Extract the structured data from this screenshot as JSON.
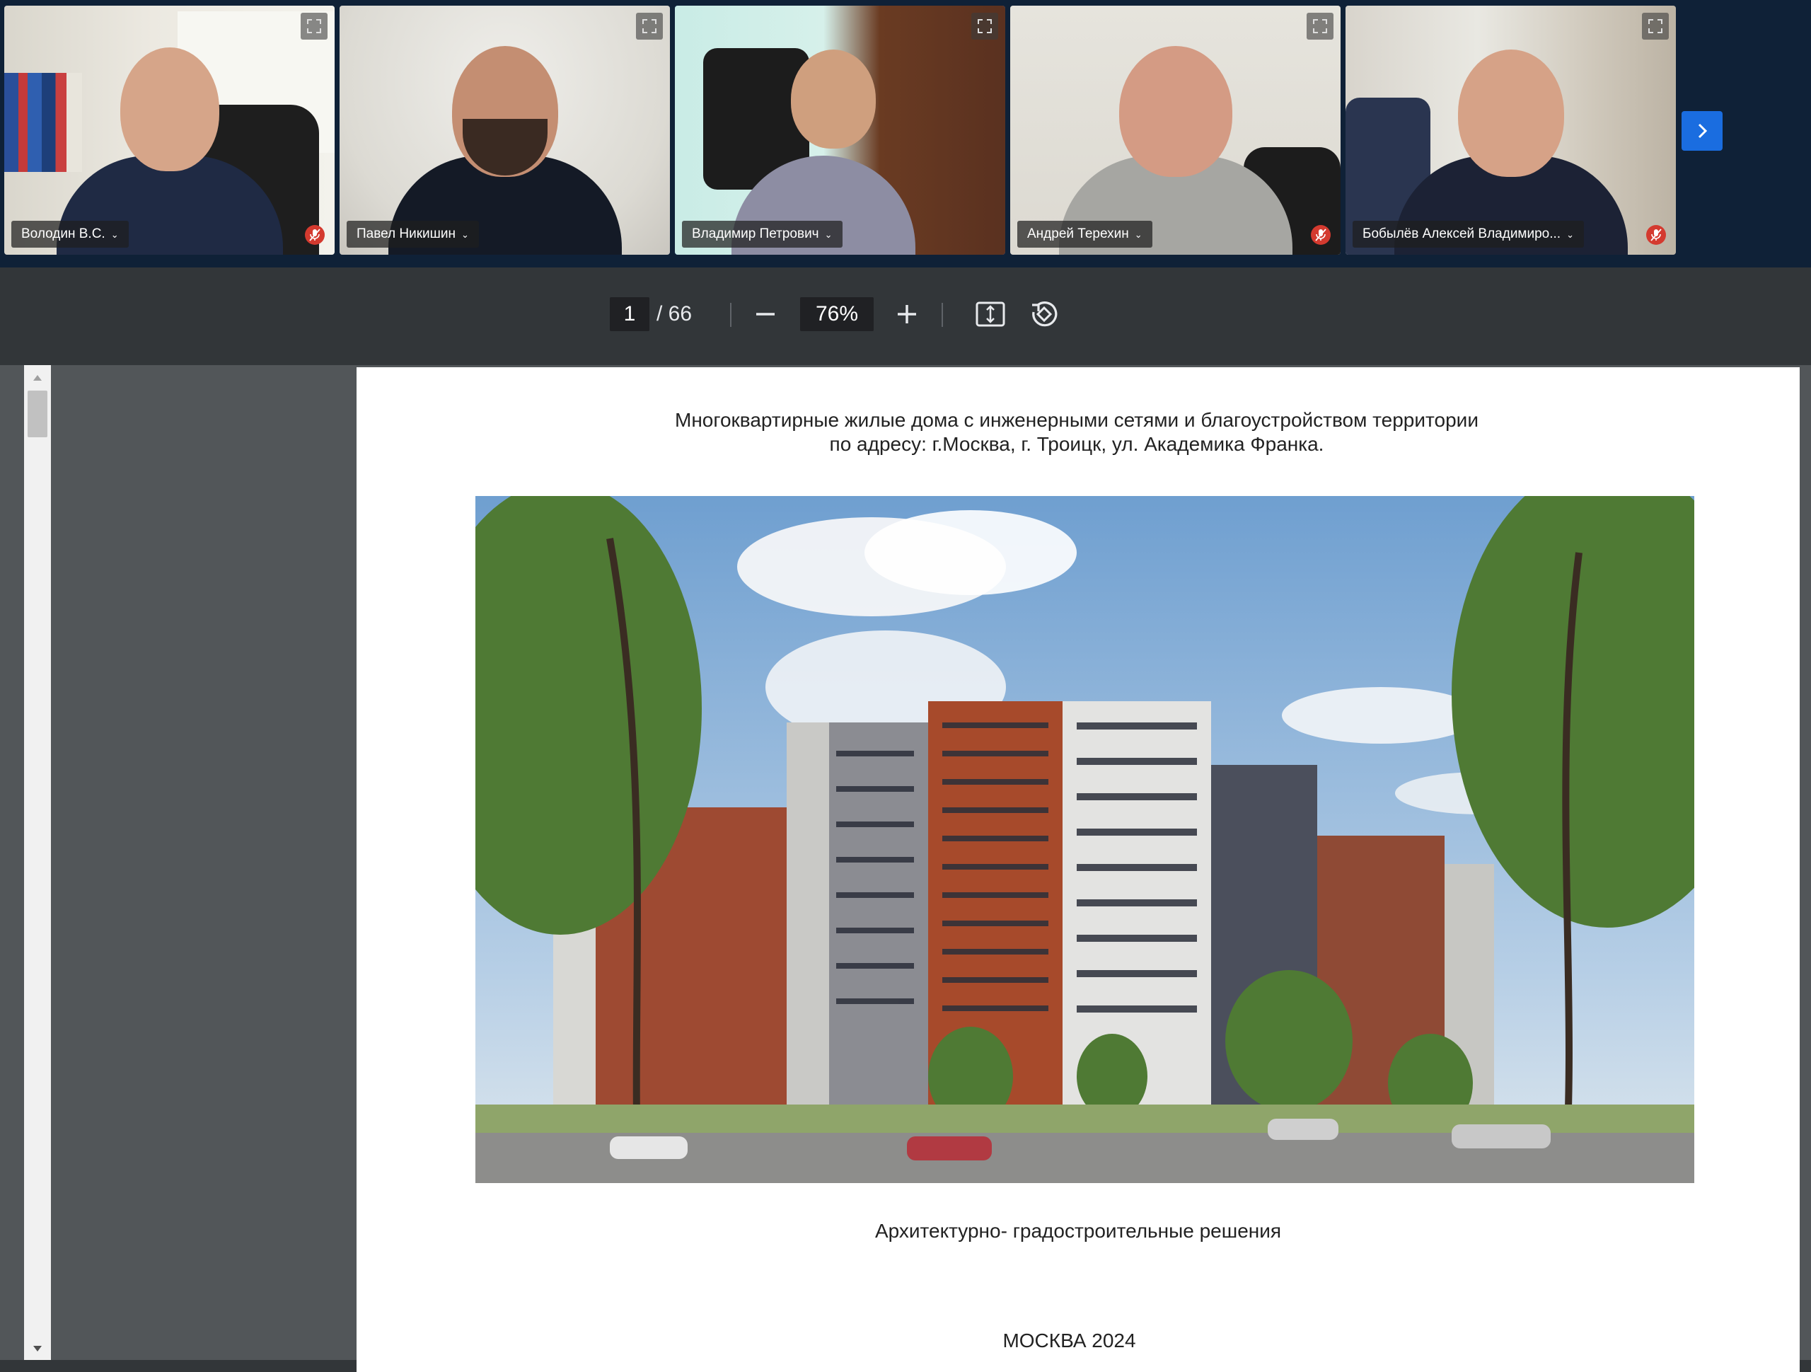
{
  "participants": [
    {
      "name": "Володин В.С.",
      "muted": true
    },
    {
      "name": "Павел Никишин",
      "muted": false
    },
    {
      "name": "Владимир Петрович",
      "muted": false,
      "active": true
    },
    {
      "name": "Андрей Терехин",
      "muted": true
    },
    {
      "name": "Бобылёв Алексей Владимиро...",
      "muted": true
    }
  ],
  "pdf_toolbar": {
    "page_current": "1",
    "page_total": "/ 66",
    "zoom": "76%"
  },
  "document": {
    "title_line1": "Многоквартирные жилые дома с инженерными сетями и благоустройством территории",
    "title_line2": "по адресу: г.Москва,  г. Троицк, ул. Академика Франка.",
    "caption": "Архитектурно- градостроительные решения",
    "city_year": "МОСКВА 2024"
  },
  "colors": {
    "strip_bg": "#0f2137",
    "active_border": "#2d6fd8",
    "next_button": "#1a6de0",
    "mute_badge": "#d43a2f",
    "toolbar_bg": "#323639",
    "viewer_bg": "#525659"
  },
  "icons": {
    "expand": "expand-icon",
    "mute": "mic-off-icon",
    "next": "chevron-right-icon",
    "zoom_out": "minus-icon",
    "zoom_in": "plus-icon",
    "fit": "fit-page-icon",
    "rotate": "rotate-icon"
  }
}
